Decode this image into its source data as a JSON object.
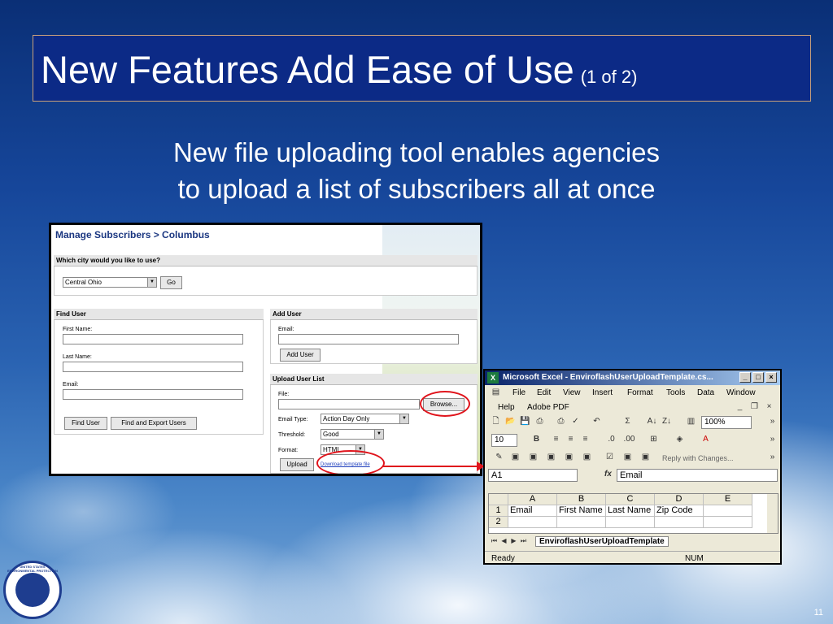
{
  "slide": {
    "title": "New Features Add Ease of Use",
    "title_suffix": "(1 of 2)",
    "subtitle_line1": "New file uploading tool enables agencies",
    "subtitle_line2": "to upload a list of subscribers all at once",
    "page_number": "11",
    "logo_text": "UNITED STATES ENVIRONMENTAL PROTECTION AGENCY"
  },
  "manage": {
    "title": "Manage Subscribers > Columbus",
    "city_question": "Which city would you like to use?",
    "city_value": "Central Ohio",
    "go_label": "Go",
    "find_user": {
      "header": "Find User",
      "first_name_label": "First Name:",
      "last_name_label": "Last Name:",
      "email_label": "Email:",
      "find_button": "Find User",
      "find_export_button": "Find and Export Users"
    },
    "add_user": {
      "header": "Add User",
      "email_label": "Email:",
      "add_button": "Add User"
    },
    "upload": {
      "header": "Upload User List",
      "file_label": "File:",
      "browse_button": "Browse...",
      "email_type_label": "Email Type:",
      "email_type_value": "Action Day Only",
      "threshold_label": "Threshold:",
      "threshold_value": "Good",
      "format_label": "Format:",
      "format_value": "HTML",
      "upload_button": "Upload",
      "template_link": "Download template file"
    }
  },
  "excel": {
    "window_title": "Microsoft Excel - EnviroflashUserUploadTemplate.cs...",
    "menus": [
      "File",
      "Edit",
      "View",
      "Insert",
      "Format",
      "Tools",
      "Data",
      "Window"
    ],
    "menus2": [
      "Help",
      "Adobe PDF"
    ],
    "zoom": "100%",
    "font_size": "10",
    "reply_with_changes": "Reply with Changes...",
    "name_box": "A1",
    "fx_label": "fx",
    "formula_value": "Email",
    "columns": [
      "A",
      "B",
      "C",
      "D",
      "E"
    ],
    "rows": [
      {
        "num": "1",
        "cells": [
          "Email",
          "First Name",
          "Last Name",
          "Zip Code",
          ""
        ]
      },
      {
        "num": "2",
        "cells": [
          "",
          "",
          "",
          "",
          ""
        ]
      }
    ],
    "sheet_tab": "EnviroflashUserUploadTemplate",
    "status_left": "Ready",
    "status_right": "NUM"
  },
  "colors": {
    "title_bg": "#0c2a86",
    "accent_red": "#e0141c",
    "excel_title": "#0a246a"
  }
}
